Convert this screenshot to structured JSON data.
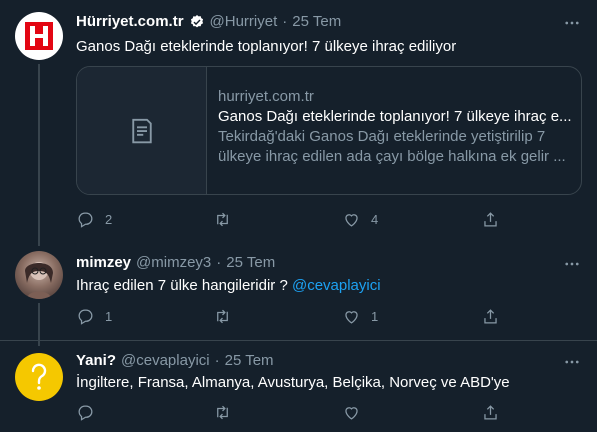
{
  "colors": {
    "background": "#15202b",
    "accent": "#1da1f2",
    "muted": "#8899a6",
    "border": "#38444d"
  },
  "tweets": [
    {
      "name": "Hürriyet.com.tr",
      "handle": "@Hurriyet",
      "separator": "·",
      "time": "25 Tem",
      "text": "Ganos Dağı eteklerinde toplanıyor! 7 ülkeye ihraç ediliyor",
      "card": {
        "domain": "hurriyet.com.tr",
        "title": "Ganos Dağı eteklerinde toplanıyor! 7 ülkeye ihraç e...",
        "description_line1": "Tekirdağ'daki Ganos Dağı eteklerinde yetiştirilip 7",
        "description_line2": "ülkeye ihraç edilen ada çayı bölge halkına ek gelir ..."
      },
      "replies": "2",
      "retweets": "",
      "likes": "4"
    },
    {
      "name": "mimzey",
      "handle": "@mimzey3",
      "separator": "·",
      "time": "25 Tem",
      "text": "Ihraç edilen 7 ülke hangileridir ? ",
      "mention": "@cevaplayici",
      "replies": "1",
      "retweets": "",
      "likes": "1"
    },
    {
      "name": "Yani?",
      "handle": "@cevaplayici",
      "separator": "·",
      "time": "25 Tem",
      "text": "İngiltere, Fransa, Almanya, Avusturya, Belçika, Norveç ve ABD'ye",
      "replies": "",
      "retweets": "",
      "likes": ""
    }
  ],
  "icons": [
    "verified-badge-icon",
    "more-icon",
    "reply-icon",
    "retweet-icon",
    "like-icon",
    "share-icon",
    "article-icon"
  ]
}
